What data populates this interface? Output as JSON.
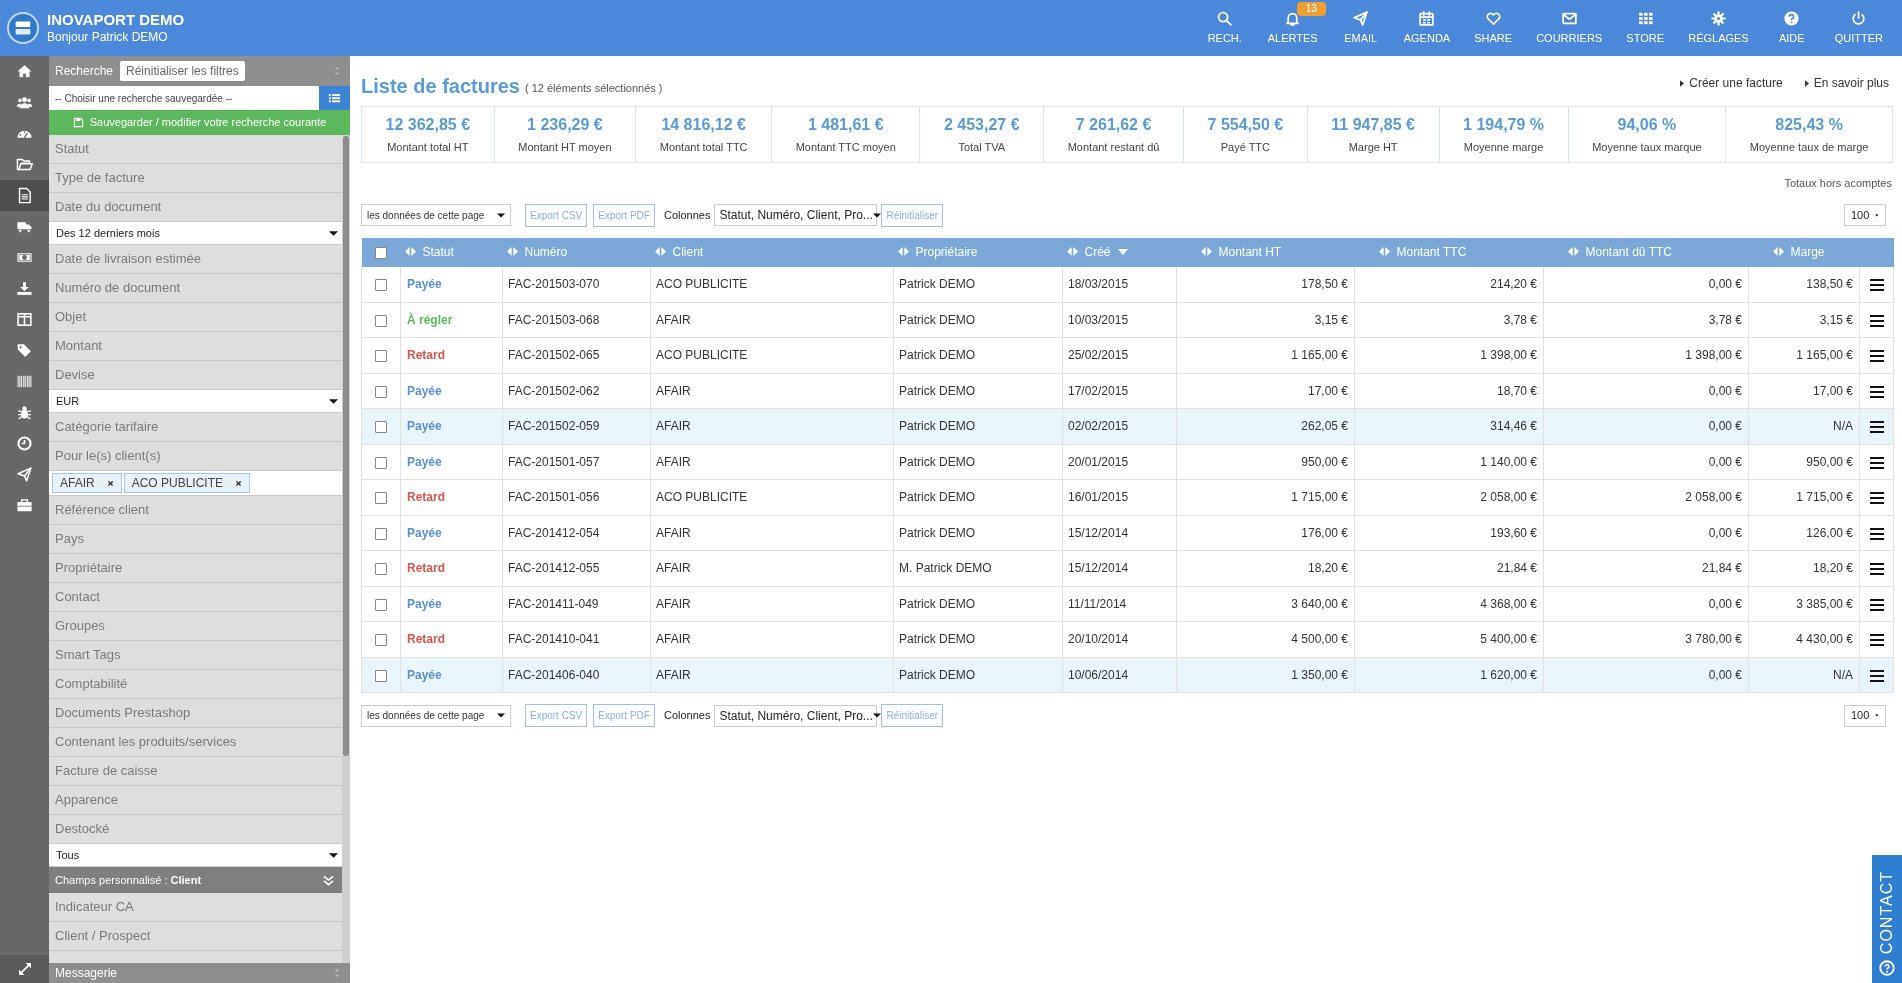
{
  "app": {
    "name": "INOVAPORT DEMO",
    "greeting": "Bonjour Patrick DEMO"
  },
  "nav": [
    {
      "label": "RECH."
    },
    {
      "label": "ALERTES",
      "badge": "13"
    },
    {
      "label": "EMAIL"
    },
    {
      "label": "AGENDA"
    },
    {
      "label": "SHARE"
    },
    {
      "label": "COURRIERS"
    },
    {
      "label": "STORE"
    },
    {
      "label": "RÉGLAGES"
    },
    {
      "label": "AIDE"
    },
    {
      "label": "QUITTER"
    }
  ],
  "rail": [
    {
      "selected": false
    },
    {
      "selected": false
    },
    {
      "selected": false
    },
    {
      "selected": false
    },
    {
      "selected": true
    },
    {
      "selected": false
    },
    {
      "selected": false
    },
    {
      "selected": false
    },
    {
      "selected": false
    },
    {
      "selected": false
    },
    {
      "selected": false
    },
    {
      "selected": false
    },
    {
      "selected": false
    },
    {
      "selected": false
    },
    {
      "selected": false
    }
  ],
  "filters": {
    "header": "Recherche",
    "reset": "Réinitialiser les filtres",
    "saved_search": "-- Choisir une recherche sauvegardée --",
    "save_button": "Sauvegarder / modifier votre recherche courante",
    "items": [
      {
        "kind": "filter",
        "label": "Statut"
      },
      {
        "kind": "filter",
        "label": "Type de facture"
      },
      {
        "kind": "filter",
        "label": "Date du document"
      },
      {
        "kind": "select",
        "value": "Des 12 derniers mois"
      },
      {
        "kind": "filter",
        "label": "Date de livraison estimée"
      },
      {
        "kind": "filter",
        "label": "Numéro de document"
      },
      {
        "kind": "filter",
        "label": "Objet"
      },
      {
        "kind": "filter",
        "label": "Montant"
      },
      {
        "kind": "filter",
        "label": "Devise"
      },
      {
        "kind": "select",
        "value": "EUR"
      },
      {
        "kind": "filter",
        "label": "Catégorie tarifaire"
      },
      {
        "kind": "filter",
        "label": "Pour le(s) client(s)"
      },
      {
        "kind": "tags",
        "tags": [
          "AFAIR",
          "ACO PUBLICITE"
        ]
      },
      {
        "kind": "filter",
        "label": "Référence client"
      },
      {
        "kind": "filter",
        "label": "Pays"
      },
      {
        "kind": "filter",
        "label": "Propriétaire"
      },
      {
        "kind": "filter",
        "label": "Contact"
      },
      {
        "kind": "filter",
        "label": "Groupes"
      },
      {
        "kind": "filter",
        "label": "Smart Tags"
      },
      {
        "kind": "filter",
        "label": "Comptabilité"
      },
      {
        "kind": "filter",
        "label": "Documents Prestashop"
      },
      {
        "kind": "filter",
        "label": "Contenant les produits/services"
      },
      {
        "kind": "filter",
        "label": "Facture de caisse"
      },
      {
        "kind": "filter",
        "label": "Apparence"
      },
      {
        "kind": "filter",
        "label": "Destocké"
      },
      {
        "kind": "select",
        "value": "Tous"
      },
      {
        "kind": "section",
        "label": "Champs personnalisé : **Client**"
      },
      {
        "kind": "filter",
        "label": "Indicateur CA"
      },
      {
        "kind": "filter",
        "label": "Client / Prospect"
      }
    ],
    "footer": "Messagerie"
  },
  "page": {
    "title": "Liste de factures",
    "subtitle": "( 12 éléments sélectionnés )",
    "links": [
      "Créer une facture",
      "En savoir plus"
    ]
  },
  "stats": [
    {
      "value": "12 362,85 €",
      "label": "Montant total HT"
    },
    {
      "value": "1 236,29 €",
      "label": "Montant HT moyen"
    },
    {
      "value": "14 816,12 €",
      "label": "Montant total TTC"
    },
    {
      "value": "1 481,61 €",
      "label": "Montant TTC moyen"
    },
    {
      "value": "2 453,27 €",
      "label": "Total TVA"
    },
    {
      "value": "7 261,62 €",
      "label": "Montant restant dû"
    },
    {
      "value": "7 554,50 €",
      "label": "Payé TTC"
    },
    {
      "value": "11 947,85 €",
      "label": "Marge HT"
    },
    {
      "value": "1 194,79 %",
      "label": "Moyenne marge"
    },
    {
      "value": "94,06 %",
      "label": "Moyenne taux marque"
    },
    {
      "value": "825,43 %",
      "label": "Moyenne taux de marge"
    }
  ],
  "totals_note": "Totaux hors acomptes",
  "toolbars": [
    {
      "scope": "les données de cette page",
      "buttons": [
        "Export CSV",
        "Export PDF"
      ],
      "columns_label": "Colonnes",
      "columns_value": "Statut, Numéro, Client, Pro...",
      "reset": "Réinitialiser",
      "page_size": "100"
    },
    {
      "scope": "les données de cette page",
      "buttons": [
        "Export CSV",
        "Export PDF"
      ],
      "columns_label": "Colonnes",
      "columns_value": "Statut, Numéro, Client, Pro...",
      "reset": "Réinitialiser",
      "page_size": "100"
    }
  ],
  "table": {
    "all_checked": false,
    "columns": [
      {
        "label": "Statut",
        "sorted": false
      },
      {
        "label": "Numéro",
        "sorted": false
      },
      {
        "label": "Client",
        "sorted": false
      },
      {
        "label": "Propriétaire",
        "sorted": false
      },
      {
        "label": "Créé",
        "sorted": true
      },
      {
        "label": "Montant HT",
        "sorted": false
      },
      {
        "label": "Montant TTC",
        "sorted": false
      },
      {
        "label": "Montant dû TTC",
        "sorted": false
      },
      {
        "label": "Marge",
        "sorted": false
      }
    ],
    "rows": [
      {
        "checked": false,
        "highlighted": false,
        "kind": "paid",
        "cells": [
          "Payée",
          "FAC-201503-070",
          "ACO PUBLICITE",
          "Patrick DEMO",
          "18/03/2015",
          "178,50 €",
          "214,20 €",
          "0,00 €",
          "138,50 €"
        ]
      },
      {
        "checked": false,
        "highlighted": false,
        "kind": "due",
        "cells": [
          "À régler",
          "FAC-201503-068",
          "AFAIR",
          "Patrick DEMO",
          "10/03/2015",
          "3,15 €",
          "3,78 €",
          "3,78 €",
          "3,15 €"
        ]
      },
      {
        "checked": false,
        "highlighted": false,
        "kind": "late",
        "cells": [
          "Retard",
          "FAC-201502-065",
          "ACO PUBLICITE",
          "Patrick DEMO",
          "25/02/2015",
          "1 165,00 €",
          "1 398,00 €",
          "1 398,00 €",
          "1 165,00 €"
        ]
      },
      {
        "checked": false,
        "highlighted": false,
        "kind": "paid",
        "cells": [
          "Payée",
          "FAC-201502-062",
          "AFAIR",
          "Patrick DEMO",
          "17/02/2015",
          "17,00 €",
          "18,70 €",
          "0,00 €",
          "17,00 €"
        ]
      },
      {
        "checked": false,
        "highlighted": true,
        "kind": "paid",
        "cells": [
          "Payée",
          "FAC-201502-059",
          "AFAIR",
          "Patrick DEMO",
          "02/02/2015",
          "262,05 €",
          "314,46 €",
          "0,00 €",
          "N/A"
        ]
      },
      {
        "checked": false,
        "highlighted": false,
        "kind": "paid",
        "cells": [
          "Payée",
          "FAC-201501-057",
          "AFAIR",
          "Patrick DEMO",
          "20/01/2015",
          "950,00 €",
          "1 140,00 €",
          "0,00 €",
          "950,00 €"
        ]
      },
      {
        "checked": false,
        "highlighted": false,
        "kind": "late",
        "cells": [
          "Retard",
          "FAC-201501-056",
          "ACO PUBLICITE",
          "Patrick DEMO",
          "16/01/2015",
          "1 715,00 €",
          "2 058,00 €",
          "2 058,00 €",
          "1 715,00 €"
        ]
      },
      {
        "checked": false,
        "highlighted": false,
        "kind": "paid",
        "cells": [
          "Payée",
          "FAC-201412-054",
          "AFAIR",
          "Patrick DEMO",
          "15/12/2014",
          "176,00 €",
          "193,60 €",
          "0,00 €",
          "126,00 €"
        ]
      },
      {
        "checked": false,
        "highlighted": false,
        "kind": "late",
        "cells": [
          "Retard",
          "FAC-201412-055",
          "AFAIR",
          "M. Patrick DEMO",
          "15/12/2014",
          "18,20 €",
          "21,84 €",
          "21,84 €",
          "18,20 €"
        ]
      },
      {
        "checked": false,
        "highlighted": false,
        "kind": "paid",
        "cells": [
          "Payée",
          "FAC-201411-049",
          "AFAIR",
          "Patrick DEMO",
          "11/11/2014",
          "3 640,00 €",
          "4 368,00 €",
          "0,00 €",
          "3 385,00 €"
        ]
      },
      {
        "checked": false,
        "highlighted": false,
        "kind": "late",
        "cells": [
          "Retard",
          "FAC-201410-041",
          "AFAIR",
          "Patrick DEMO",
          "20/10/2014",
          "4 500,00 €",
          "5 400,00 €",
          "3 780,00 €",
          "4 430,00 €"
        ]
      },
      {
        "checked": false,
        "highlighted": true,
        "kind": "paid",
        "cells": [
          "Payée",
          "FAC-201406-040",
          "AFAIR",
          "Patrick DEMO",
          "10/06/2014",
          "1 350,00 €",
          "1 620,00 €",
          "0,00 €",
          "N/A"
        ]
      }
    ]
  },
  "contact_tab": "CONTACT"
}
